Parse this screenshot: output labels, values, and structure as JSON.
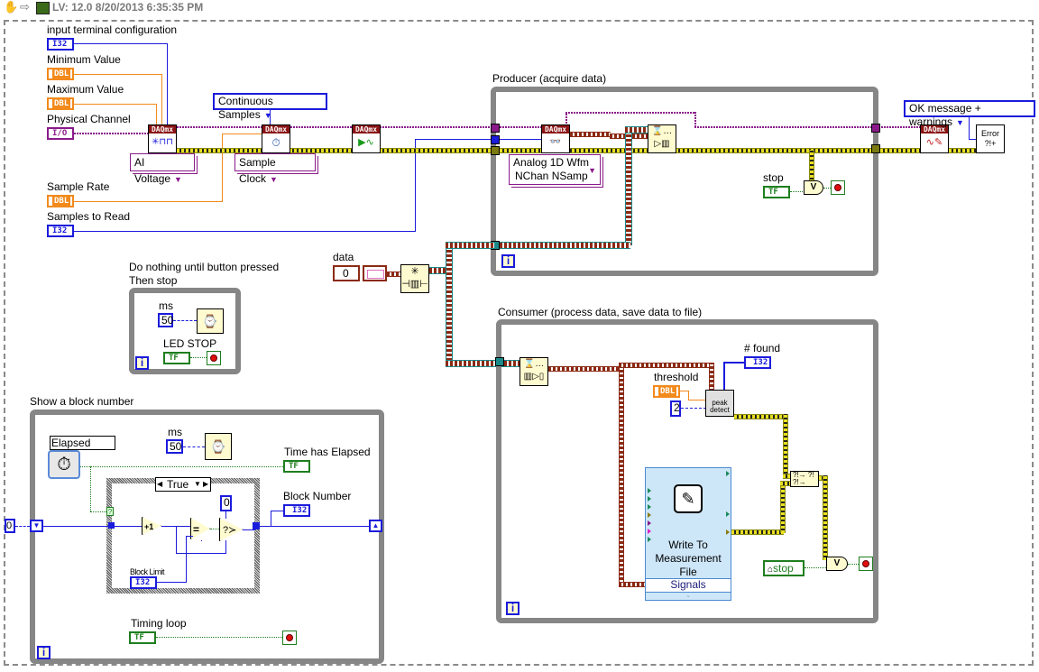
{
  "toolbar": {
    "title": "LV: 12.0 8/20/2013 6:35:35 PM",
    "icons": [
      "hand-tool-icon",
      "run-arrow-icon",
      "vi-icon"
    ]
  },
  "controls": {
    "input_terminal_configuration": {
      "label": "input terminal configuration",
      "type": "I32"
    },
    "minimum_value": {
      "label": "Minimum Value",
      "type": "DBL"
    },
    "maximum_value": {
      "label": "Maximum Value",
      "type": "DBL"
    },
    "physical_channel": {
      "label": "Physical Channel",
      "type": "I/O"
    },
    "sample_rate": {
      "label": "Sample Rate",
      "type": "DBL"
    },
    "samples_to_read": {
      "label": "Samples to Read",
      "type": "I32"
    }
  },
  "daqmx": {
    "header": "DAQmx",
    "create_channel_ring": "AI Voltage",
    "timing_ring": "Sample Clock",
    "sample_mode_enum": "Continuous Samples",
    "read_ring_line1": "Analog 1D Wfm",
    "read_ring_line2": "NChan NSamp",
    "error_mode_enum": "OK message + warnings",
    "error_icon_text": "Error ?!+"
  },
  "producer": {
    "label": "Producer (acquire data)",
    "stop_label": "stop",
    "tf": "TF",
    "iter": "i"
  },
  "queue": {
    "data_label": "data",
    "data_value": "0"
  },
  "idle_loop": {
    "label_line1": "Do nothing until button pressed",
    "label_line2": "Then stop",
    "ms_label": "ms",
    "ms_value": "50",
    "stop_label": "LED STOP",
    "tf": "TF",
    "iter": "i"
  },
  "block_loop": {
    "label": "Show a block number",
    "elapsed_time": "Elapsed Time",
    "ms_label": "ms",
    "ms_value": "50",
    "time_elapsed_label": "Time has Elapsed",
    "tf": "TF",
    "case_selector": "True",
    "increment": "+1",
    "equals": "=",
    "zero_const": "0",
    "block_limit_label": "Block Limit",
    "block_limit_type": "I32",
    "block_number_label": "Block Number",
    "block_number_type": "I32",
    "shift_init": "0",
    "timing_loop_label": "Timing loop",
    "iter": "i",
    "question": "?"
  },
  "consumer": {
    "label": "Consumer (process data, save data to file)",
    "threshold_label": "threshold",
    "threshold_type": "DBL",
    "width_const": "2",
    "found_label": "# found",
    "found_type": "I32",
    "peak_detect": "peak detect",
    "wmf_line1": "Write To",
    "wmf_line2": "Measurement",
    "wmf_line3": "File",
    "wmf_signals": "Signals",
    "stop_label": "stop",
    "iter": "i"
  },
  "colors": {
    "numeric_int": "#1b1bdc",
    "numeric_dbl": "#f28a1c",
    "boolean": "#1e7e1e",
    "io_purple": "#8a1a8a",
    "error_yellow": "#e8e020",
    "daqmx_red": "#8b1414",
    "loop_gray": "#868686",
    "waveform_brown": "#8b2a14",
    "queue_teal": "#1a8a8a"
  }
}
